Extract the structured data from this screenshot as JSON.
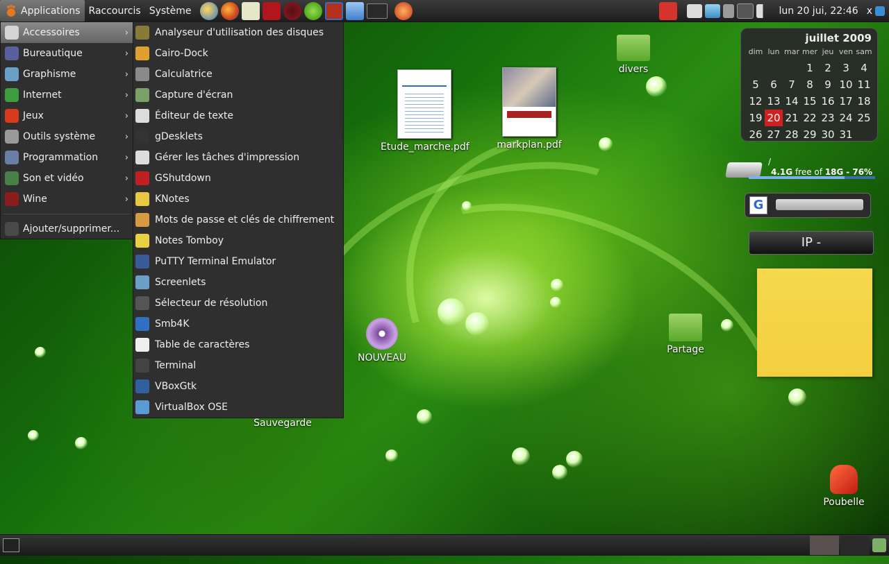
{
  "top_panel": {
    "applications": "Applications",
    "raccourcis": "Raccourcis",
    "systeme": "Système",
    "clock": "lun 20 jui, 22:46",
    "close_label": "x"
  },
  "apps_menu": {
    "items": [
      {
        "label": "Accessoires",
        "icon": "accessories-icon"
      },
      {
        "label": "Bureautique",
        "icon": "office-icon"
      },
      {
        "label": "Graphisme",
        "icon": "graphics-icon"
      },
      {
        "label": "Internet",
        "icon": "internet-icon"
      },
      {
        "label": "Jeux",
        "icon": "games-icon"
      },
      {
        "label": "Outils système",
        "icon": "system-tools-icon"
      },
      {
        "label": "Programmation",
        "icon": "programming-icon"
      },
      {
        "label": "Son et vidéo",
        "icon": "sound-video-icon"
      },
      {
        "label": "Wine",
        "icon": "wine-icon"
      }
    ],
    "add_remove": "Ajouter/supprimer..."
  },
  "sub_menu": {
    "items": [
      "Analyseur d'utilisation des disques",
      "Cairo-Dock",
      "Calculatrice",
      "Capture d'écran",
      "Éditeur de texte",
      "gDesklets",
      "Gérer les tâches d'impression",
      "GShutdown",
      "KNotes",
      "Mots de passe et clés de chiffrement",
      "Notes Tomboy",
      "PuTTY Terminal Emulator",
      "Screenlets",
      "Sélecteur de résolution",
      "Smb4K",
      "Table de caractères",
      "Terminal",
      "VBoxGtk",
      "VirtualBox OSE"
    ]
  },
  "desktop": {
    "etude": "Etude_marche.pdf",
    "markplan": "markplan.pdf",
    "divers": "divers",
    "nouveau": "NOUVEAU",
    "partage": "Partage",
    "sauvegarde": "Sauvegarde",
    "poubelle": "Poubelle"
  },
  "calendar": {
    "title": "juillet 2009",
    "weekdays": [
      "dim",
      "lun",
      "mar",
      "mer",
      "jeu",
      "ven",
      "sam"
    ],
    "today": "20"
  },
  "disk": {
    "mount": "/",
    "free": "4.1G",
    "free_text": "free of",
    "total": "18G",
    "percent_text": "- 76%",
    "percent": 76
  },
  "ip_widget": {
    "label": "IP -"
  },
  "colors": {
    "panel": "#2a2a2a",
    "today": "#d21f1f",
    "note": "#f5d547"
  }
}
